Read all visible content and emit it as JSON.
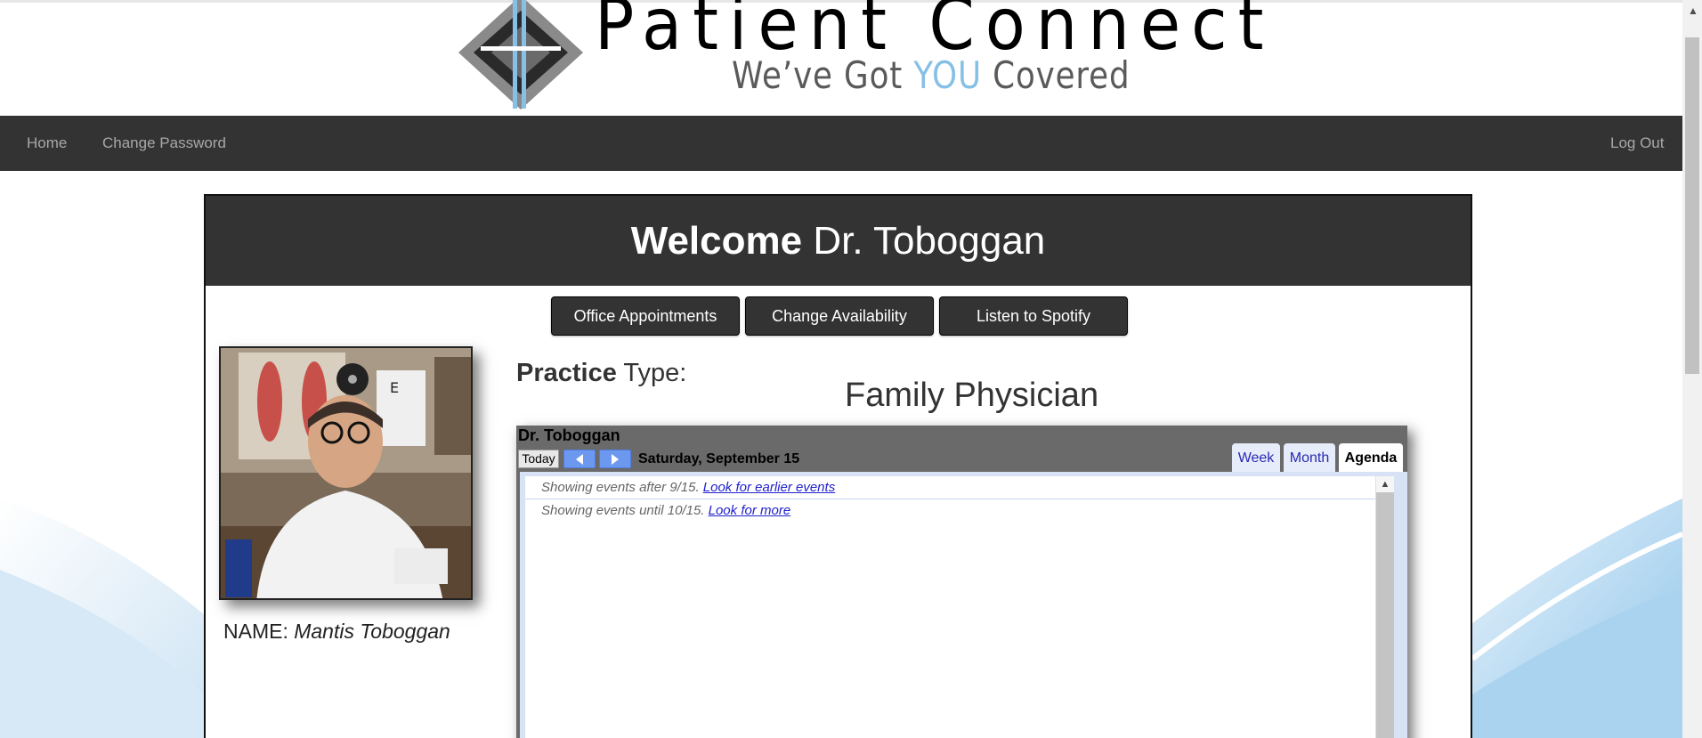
{
  "logo": {
    "title": "Patient Connect",
    "tagline_pre": "We’ve Got ",
    "tagline_highlight": "YOU",
    "tagline_post": " Covered"
  },
  "nav": {
    "home": "Home",
    "change_password": "Change Password",
    "logout": "Log Out"
  },
  "panel": {
    "welcome_bold": "Welcome",
    "welcome_name": " Dr. Toboggan",
    "buttons": [
      "Office Appointments",
      "Change Availability",
      "Listen to Spotify"
    ],
    "name_label": "NAME: ",
    "name_value": "Mantis Toboggan",
    "practice_bold": "Practice",
    "practice_rest": " Type:",
    "practice_value": "Family Physician"
  },
  "calendar": {
    "title": "Dr. Toboggan",
    "today_label": "Today",
    "date_label": "Saturday, September 15",
    "tabs": [
      "Week",
      "Month",
      "Agenda"
    ],
    "active_tab": "Agenda",
    "row1_text": "Showing events after 9/15. ",
    "row1_link": "Look for earlier events",
    "row2_text": "Showing events until 10/15. ",
    "row2_link": "Look for more"
  },
  "colors": {
    "nav_bg": "#333333",
    "accent_blue": "#86c0e6",
    "calendar_nav": "#6d98f0"
  }
}
